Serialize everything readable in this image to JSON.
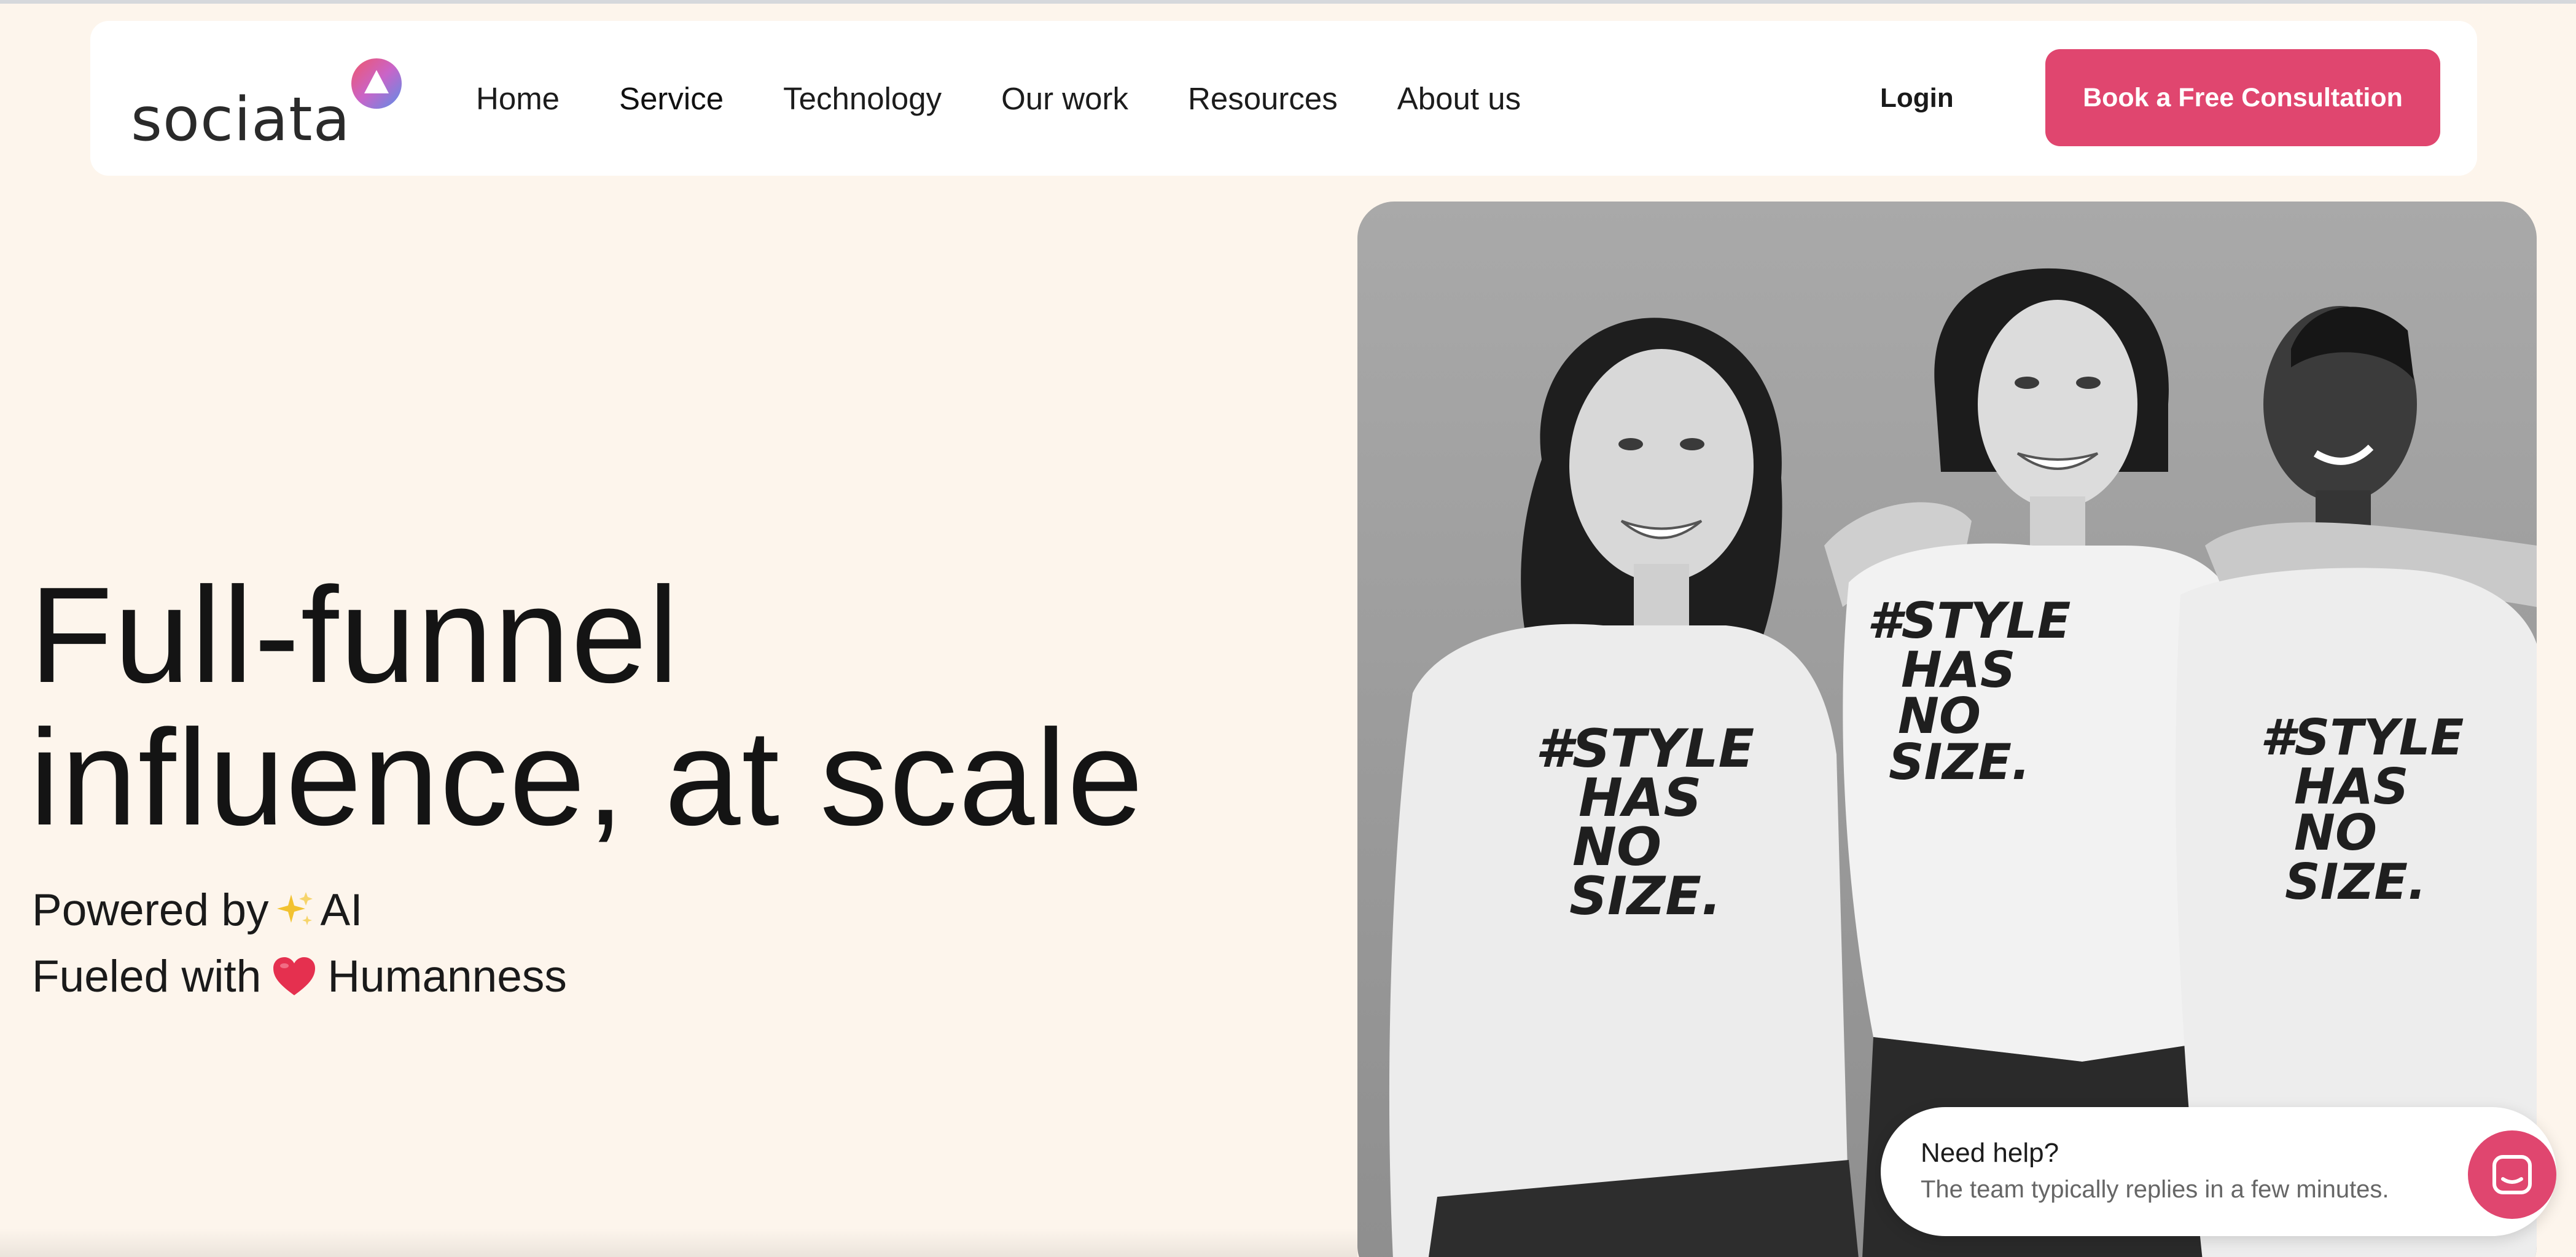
{
  "brand": {
    "name": "sociata",
    "accent_color": "#e0466f",
    "background_color": "#fdf5ec"
  },
  "nav": {
    "items": [
      {
        "label": "Home"
      },
      {
        "label": "Service"
      },
      {
        "label": "Technology"
      },
      {
        "label": "Our work"
      },
      {
        "label": "Resources"
      },
      {
        "label": "About us"
      }
    ],
    "login_label": "Login",
    "cta_label": "Book a Free Consultation"
  },
  "hero": {
    "title_line1": "Full-funnel",
    "title_line2": "influence, at scale",
    "tagline1_prefix": "Powered by",
    "tagline1_icon": "sparkles-icon",
    "tagline1_suffix": "AI",
    "tagline2_prefix": "Fueled with",
    "tagline2_icon": "heart-icon",
    "tagline2_suffix": "Humanness",
    "image": {
      "description_icon": "photo-three-women",
      "shirt_text_line1": "#STYLE",
      "shirt_text_line2": "HAS",
      "shirt_text_line3": "NO",
      "shirt_text_line4": "SIZE."
    }
  },
  "chat": {
    "title": "Need help?",
    "subtitle": "The team typically replies in a few minutes.",
    "launcher_icon": "chat-icon"
  }
}
